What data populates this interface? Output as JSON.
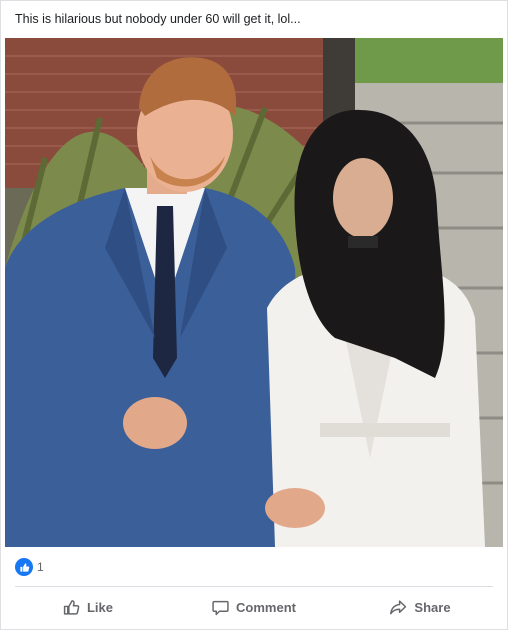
{
  "post": {
    "caption": "This is hilarious but nobody under 60 will get it, lol...",
    "photo_icon": "photo-of-couple"
  },
  "reactions": {
    "icon": "like-icon",
    "count": "1",
    "color": "#1877f2"
  },
  "actions": [
    {
      "label": "Like",
      "icon": "thumbs-up-icon"
    },
    {
      "label": "Comment",
      "icon": "comment-icon"
    },
    {
      "label": "Share",
      "icon": "share-icon"
    }
  ]
}
